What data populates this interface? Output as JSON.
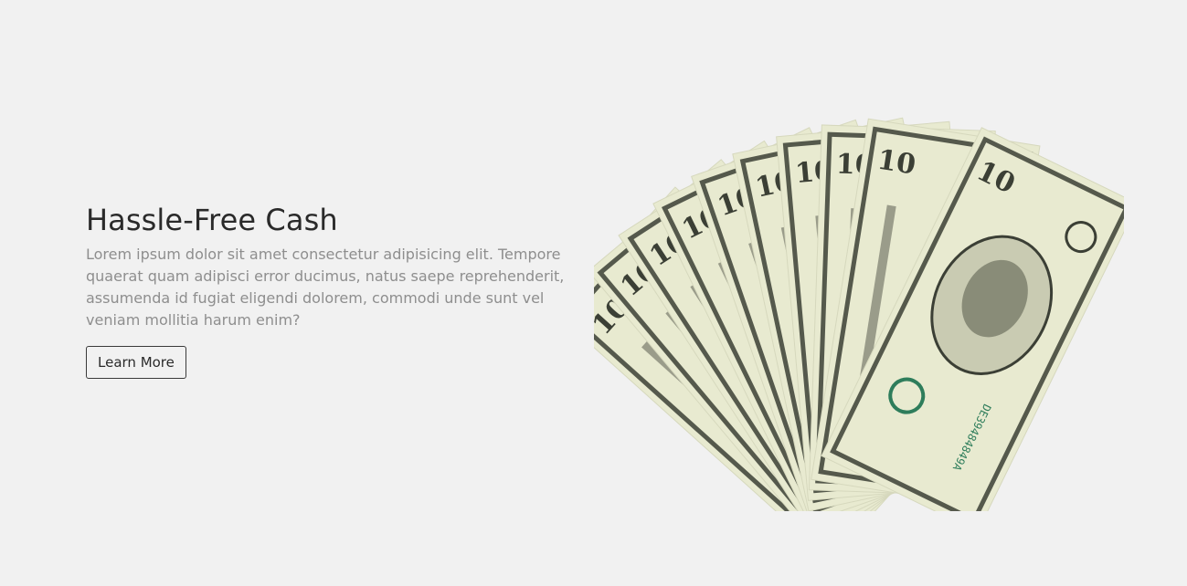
{
  "hero": {
    "title": "Hassle-Free Cash",
    "description": "Lorem ipsum dolor sit amet consectetur adipisicing elit. Tempore quaerat quam adipisci error ducimus, natus saepe reprehenderit, assumenda id fugiat eligendi dolorem, commodi unde sunt vel veniam mollitia harum enim?",
    "button_label": "Learn More"
  },
  "image": {
    "subject": "fan of ten-dollar bills",
    "serial": "DE39484849A",
    "denomination": "10"
  },
  "colors": {
    "background": "#f1f1f1",
    "title": "#2a2a2a",
    "body": "#8e8e8e",
    "bill_paper": "#e8ead0",
    "bill_ink": "#3b3f35",
    "seal_green": "#2e7d5b"
  }
}
